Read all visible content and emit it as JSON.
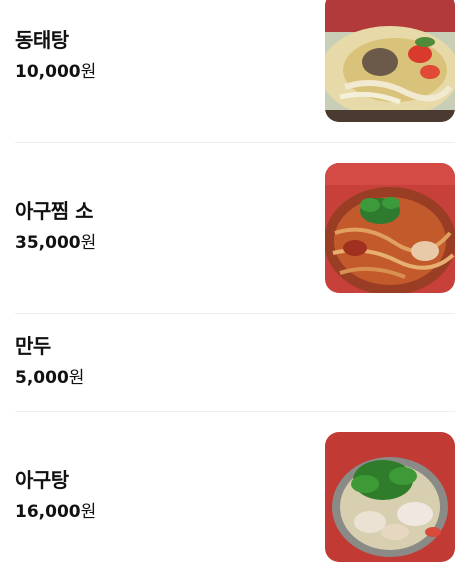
{
  "menu": {
    "items": [
      {
        "name": "동태탕",
        "price": "10,000",
        "unit": "원",
        "has_photo": true
      },
      {
        "name": "아구찜 소",
        "price": "35,000",
        "unit": "원",
        "has_photo": true
      },
      {
        "name": "만두",
        "price": "5,000",
        "unit": "원",
        "has_photo": false
      },
      {
        "name": "아구탕",
        "price": "16,000",
        "unit": "원",
        "has_photo": true
      }
    ]
  },
  "colors": {
    "text": "#111111",
    "divider": "#eeeeee"
  }
}
